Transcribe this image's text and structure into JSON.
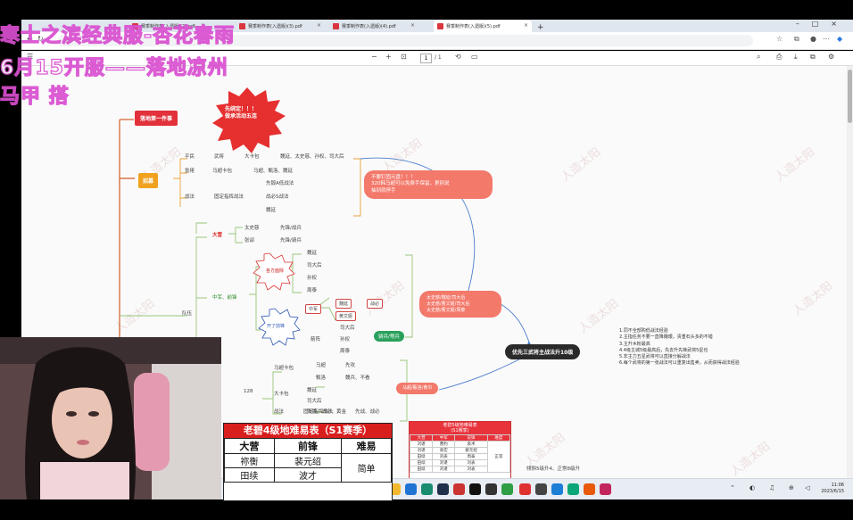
{
  "overlay": {
    "line1": "寒士之滨经典服-杏花春雨",
    "line2": "6月15开服——落地凉州",
    "line3": "马甲 搭"
  },
  "browser": {
    "tabs": [
      {
        "label": "赛季制作表(入遗版)(2).pdf"
      },
      {
        "label": "赛季制作表(入遗版)(3).pdf"
      },
      {
        "label": "赛季制作表(入遗版)(4).pdf"
      },
      {
        "label": "赛季制作表(入遗版)(5).pdf"
      }
    ],
    "address": "C/...",
    "page_current": "1",
    "page_total": "/ 1"
  },
  "mindmap": {
    "top_node": "落地第一件事",
    "starburst": "先绑定！！！\n做承活动五连",
    "orange_node": "招募",
    "rows_recruit": [
      {
        "a": "平民",
        "b": "武将",
        "c": "大卡包",
        "d": "魏延、太史慈、孙权、司大后"
      },
      {
        "a": "氪佬",
        "b": "马超卡包",
        "c": "马超、甄洛、魏延"
      },
      {
        "a": "",
        "b": "",
        "c": "先锻A低战法"
      },
      {
        "a": "战法",
        "b": "固定指挥战法",
        "c": "战必S战法"
      },
      {
        "a": "",
        "b": "",
        "c": "魏延"
      }
    ],
    "pill_right": "不要钉固元盘！！！\n320韩马超可以免费手保留，更别说\n抽到就停手",
    "camp_label": "大营",
    "camp_rows": [
      {
        "a": "太史慈",
        "b": "先锋/战兵"
      },
      {
        "a": "张郃",
        "b": "先锋/骑兵"
      }
    ],
    "burst1": "各方面除",
    "burst2": "开了前锋",
    "mid_list": [
      "魏延",
      "司大后",
      "孙权",
      "周泰"
    ],
    "mid_label": "中军、前锋",
    "army_label": "队伍",
    "box_zhongjun": "中军",
    "box_weiyan": "魏延",
    "box_huangzhong": "黄文姬",
    "box_zhanbi": "战必",
    "sub_list2": [
      "司大后",
      "孙权",
      "周泰"
    ],
    "gongpo": "箭阵",
    "green_node": "骑兵/弩兵",
    "pill_mid": "太史慈/魏延/司大后\n太史慈/曹文姬/司大后\n太史慈/曹文姬/周泰",
    "dark_node": "优先三武将主战法升10级",
    "notes": [
      {
        "t": "1.同不全部购低战法经验",
        "red": true
      },
      {
        "t": "2.主指任务不要一直降魏艰，贵重石头多的不错",
        "red": false
      },
      {
        "t": "3.主升木粉最高",
        "red": true
      },
      {
        "t": "4.4级主城5级最高后，先去升先锋武将5星也",
        "red": true
      },
      {
        "t": "5.非主力五星武将可以直接分解战法",
        "red": false
      },
      {
        "t": "6.每个武将的第一张战法可以重复出售卖，从而获得战法经验",
        "red": false
      }
    ],
    "lower_128": "128",
    "lower_rows": [
      {
        "a": "马超卡包",
        "b": "马超",
        "c": "先攻"
      },
      {
        "a": "",
        "b": "甄洛",
        "c": "魏兵、不看"
      },
      {
        "a": "大卡包",
        "b": "魏延",
        "c": ""
      },
      {
        "a": "",
        "b": "司大后",
        "c": ""
      },
      {
        "a": "",
        "b": "先锻、战必、黄金",
        "c": ""
      },
      {
        "a": "战法",
        "b": "固定指挥战法",
        "c": "先战、战必"
      }
    ],
    "pill_low": "马超/甄洛/黄巾",
    "bottom_note": "倾斜5级升4、正常8级升"
  },
  "table1": {
    "title": "老碧4级地难易表（S1赛季）",
    "header": [
      "大营",
      "前锋",
      "难易"
    ],
    "rows": [
      [
        "祢衡",
        "裴元绍",
        "简单"
      ],
      [
        "田续",
        "波才",
        ""
      ]
    ]
  },
  "table2": {
    "title": "老碧5级地难易表",
    "subtitle": "(S1赛季)",
    "header": [
      "大营",
      "中军",
      "前锋",
      "难度"
    ],
    "rows": [
      [
        "刘谌",
        "曹豹",
        "袁术",
        ""
      ],
      [
        "刘谌",
        "袁宏",
        "裴元绍",
        "正常"
      ],
      [
        "田续",
        "刘表",
        "周泰",
        ""
      ],
      [
        "田续",
        "刘谌",
        "刘表",
        ""
      ],
      [
        "田续",
        "刘谌",
        "刘表",
        ""
      ]
    ]
  },
  "taskbar": {
    "search_placeholder": "搜索",
    "time": "11:06",
    "date": "2023/6/15"
  },
  "watermark": "人造太阳"
}
